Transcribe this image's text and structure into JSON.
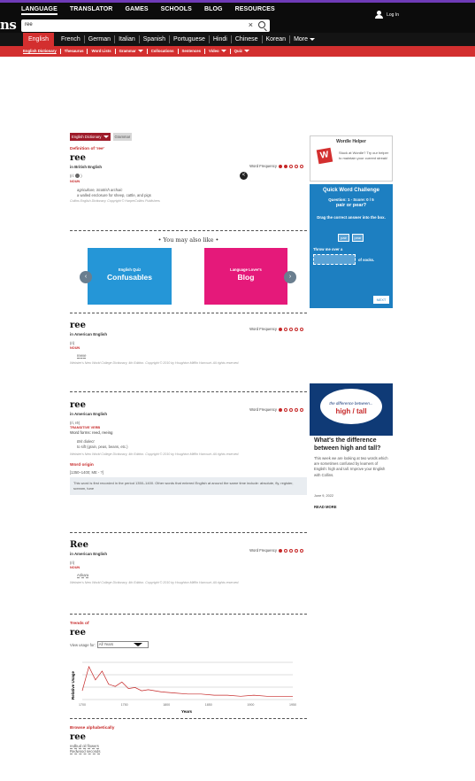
{
  "brand": "ns",
  "topnav": [
    "LANGUAGE",
    "TRANSLATOR",
    "GAMES",
    "SCHOOLS",
    "BLOG",
    "RESOURCES"
  ],
  "login": "Log In",
  "search": {
    "value": "ree"
  },
  "languages": [
    "English",
    "French",
    "German",
    "Italian",
    "Spanish",
    "Portuguese",
    "Hindi",
    "Chinese",
    "Korean",
    "More"
  ],
  "subnav": [
    "English Dictionary",
    "Thesaurus",
    "Word Lists",
    "Grammar",
    "Collocations",
    "Sentences",
    "Video",
    "Quiz"
  ],
  "tabs": [
    "English Dictionary",
    "Grammar"
  ],
  "british": {
    "definition_label": "Definition of 'ree'",
    "word": "ree",
    "region": "in British English",
    "pron": "(ri:",
    "pos": "NOUN",
    "domain": "agriculture, Scottish archaic",
    "definition": "a walled enclosure for sheep, cattle, and pigs",
    "copyright": "Collins English Dictionary. Copyright © HarperCollins Publishers",
    "freq_label": "Word Frequency"
  },
  "may_also_like": "• You may also like •",
  "cards": [
    {
      "title": "English Quiz",
      "big": "Confusables"
    },
    {
      "title": "Language Lover's",
      "big": "Blog"
    }
  ],
  "american1": {
    "word": "ree",
    "region": "in American English",
    "pron": "(ri)",
    "pos": "NOUN",
    "definition": "reeve",
    "copyright": "Webster's New World College Dictionary, 4th Edition. Copyright © 2010 by Houghton Mifflin Harcourt. All rights reserved.",
    "freq_label": "Word Frequency"
  },
  "american2": {
    "word": "ree",
    "region": "in American English",
    "pron": "(ri, rē)",
    "pos": "TRANSITIVE VERB",
    "forms": "Word forms: reed, reeing",
    "dialect": "Brit dialect",
    "definition": "to sift (grain, peas, beans, etc.)",
    "copyright": "Webster's New World College Dictionary, 4th Edition. Copyright © 2010 by Houghton Mifflin Harcourt. All rights reserved.",
    "freq_label": "Word Frequency",
    "origin_label": "Word origin",
    "origin_date": "[1350–1400; ME - ?]",
    "origin_text": "This word is first recorded in the period 1350–1400. Other words that entered English at around the same time include: absolute, fly, register, scream, tune"
  },
  "american3": {
    "word": "Ree",
    "region": "in American English",
    "pron": "(ri)",
    "pos": "NOUN",
    "definition": "Arikara",
    "copyright": "Webster's New World College Dictionary, 4th Edition. Copyright © 2010 by Houghton Mifflin Harcourt. All rights reserved.",
    "freq_label": "Word Frequency"
  },
  "trends": {
    "label": "Trends of",
    "word": "ree",
    "view_label": "View usage for:",
    "select_value": "All Years"
  },
  "chart_data": {
    "type": "line",
    "title": "",
    "xlabel": "Years",
    "ylabel": "Relative Usage",
    "x": [
      1700,
      1710,
      1720,
      1730,
      1740,
      1750,
      1760,
      1770,
      1780,
      1790,
      1800,
      1820,
      1840,
      1860,
      1880,
      1900,
      1920,
      1940,
      1960,
      1980,
      2000,
      2019
    ],
    "series": [
      {
        "values": [
          8,
          30,
          18,
          26,
          14,
          12,
          16,
          10,
          11,
          8,
          9,
          7,
          6,
          5,
          5,
          4,
          4,
          3,
          4,
          3,
          3,
          3
        ]
      }
    ],
    "xticks": [
      "1700",
      "1750",
      "1800",
      "1850",
      "1900",
      "1950"
    ],
    "grid": true
  },
  "browse": {
    "label": "Browse alphabetically",
    "word": "ree",
    "items": [
      "redbud oil flowers",
      "Redwood seconds"
    ]
  },
  "sidebar": {
    "helper_title": "Wordle Helper",
    "helper_text": "Stuck at Wordle? Try our helper to maintain your current streak!",
    "challenge_title": "Quick Word Challenge",
    "question": "Question: 1 - Score: 0 / 5",
    "pair": "pair or pear?",
    "drag": "Drag the correct answer into the box.",
    "options": [
      "pair",
      "pear"
    ],
    "throw": "Throw me over a",
    "socks": "of socks.",
    "next": "NEXT",
    "promo_italic": "the difference between...",
    "promo_big": "high / tall",
    "promo_title": "What's the difference between high and tall?",
    "promo_desc": "This week we are looking at two words which are sometimes confused by learners of English: high and tall. Improve your English with Collins.",
    "promo_date": "June 9, 2022",
    "promo_more": "READ MORE"
  },
  "colors": {
    "accent": "#d32f2f",
    "topbar": "#0c0c0c",
    "challenge": "#1d7fc1",
    "promo": "#0f3a76"
  }
}
